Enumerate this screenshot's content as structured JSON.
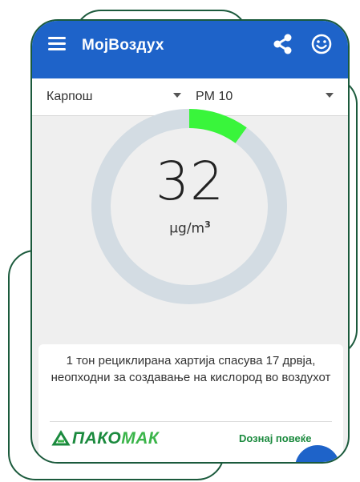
{
  "app": {
    "title": "МојВоздух"
  },
  "filters": {
    "city": "Карпош",
    "pollutant": "PM 10"
  },
  "reading": {
    "value": "32",
    "unit_base": "μg/m",
    "unit_exp": "3",
    "gauge_fraction": 0.1
  },
  "colors": {
    "primary": "#1e63c9",
    "gauge_track": "#d3dce3",
    "gauge_level": "#39f53b",
    "brand_green": "#1b8a3e",
    "frame": "#1b5a3c"
  },
  "ad": {
    "text": "1 тон рециклирана хартија спасува 17 дрвја, неопходни за создавање на кислород во воздухот",
    "brand_part1": "ПАКО",
    "brand_part2": "МАК",
    "link": "Dознај повеќе"
  },
  "icons": {
    "menu": "hamburger-menu-icon",
    "share": "share-icon",
    "feedback": "smiley-face-icon",
    "brand": "recycle-leaf-icon"
  }
}
